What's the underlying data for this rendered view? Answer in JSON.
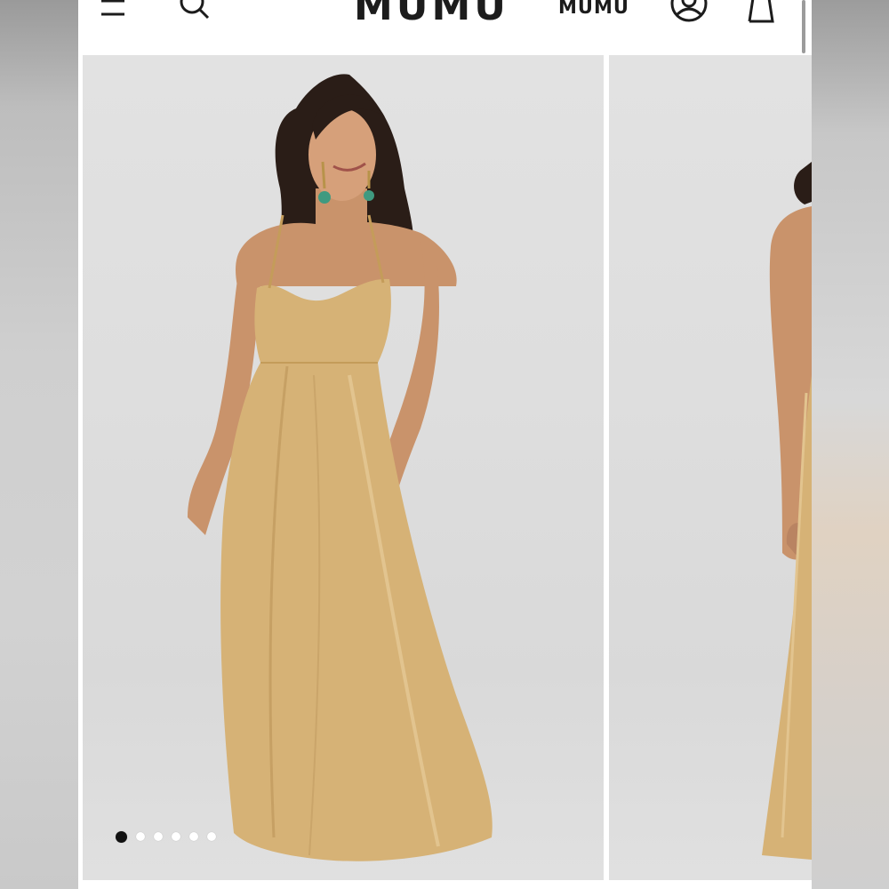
{
  "header": {
    "logo_text": "MUMU",
    "secondary_logo_text": "MUMU",
    "icons": [
      "menu-icon",
      "search-icon",
      "account-icon",
      "shopping-bag-icon"
    ]
  },
  "gallery": {
    "slide_count": 6,
    "active_slide": 1,
    "images": [
      {
        "name": "product-photo-front",
        "description_visible": false
      },
      {
        "name": "product-photo-back",
        "description_visible": false
      }
    ]
  },
  "colors": {
    "dress_gold": "#d6b276",
    "background_gray": "#dedede",
    "text_dark": "#1c1c1c",
    "dot_active": "#111111",
    "dot_inactive": "#ffffff"
  }
}
